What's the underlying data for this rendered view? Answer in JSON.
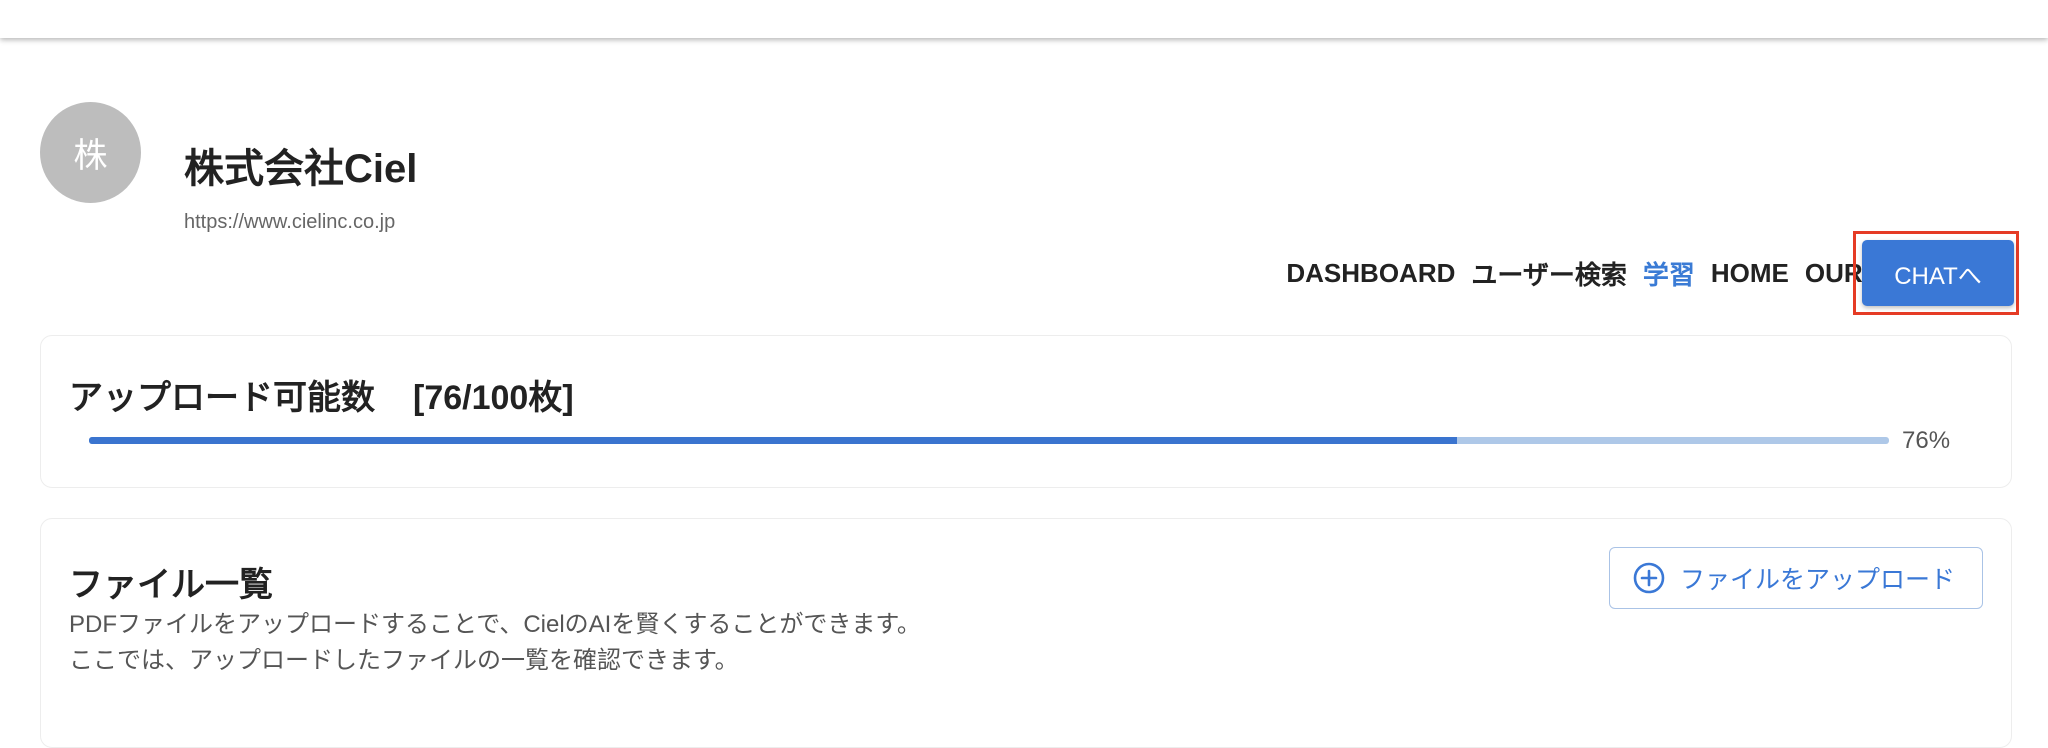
{
  "company": {
    "avatar_initial": "株",
    "name": "株式会社Ciel",
    "url": "https://www.cielinc.co.jp"
  },
  "nav": {
    "items": [
      {
        "label": "DASHBOARD",
        "active": false
      },
      {
        "label": "ユーザー検索",
        "active": false
      },
      {
        "label": "学習",
        "active": true
      },
      {
        "label": "HOME",
        "active": false
      },
      {
        "label": "OURS",
        "active": false
      }
    ],
    "chat_button": "CHATへ"
  },
  "upload_quota": {
    "title": "アップロード可能数",
    "count": "[76/100枚]",
    "progress_percent": 76,
    "progress_label": "76%"
  },
  "files": {
    "title": "ファイル一覧",
    "description_line1": "PDFファイルをアップロードすることで、CielのAIを賢くすることができます。",
    "description_line2": "ここでは、アップロードしたファイルの一覧を確認できます。",
    "upload_button": "ファイルをアップロード"
  },
  "colors": {
    "accent": "#3a78d6",
    "highlight": "#e53b25",
    "avatar_bg": "#bdbdbd",
    "progress_track": "#aec8e8"
  }
}
